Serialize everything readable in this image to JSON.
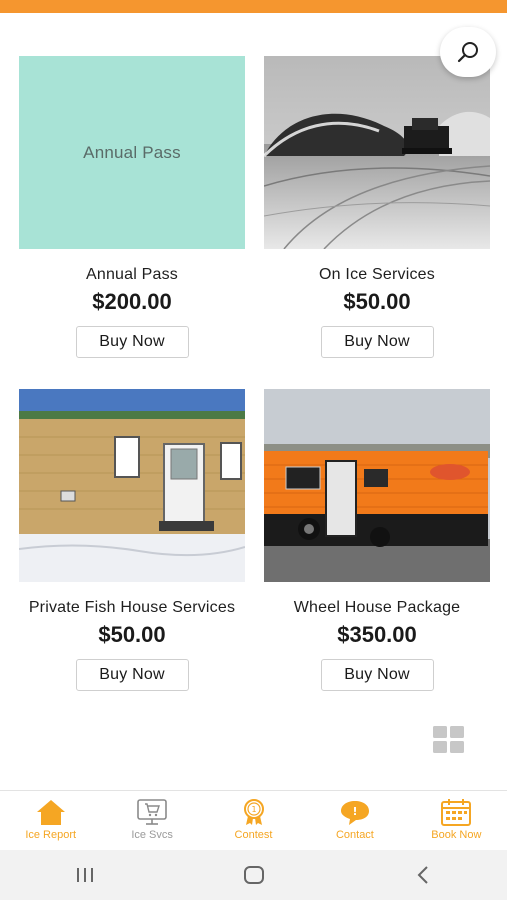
{
  "colors": {
    "accent": "#F5962F",
    "nav_active": "#F5A623",
    "placeholder_bg": "#A8E3D6"
  },
  "products": [
    {
      "name": "Annual Pass",
      "price": "$200.00",
      "button": "Buy Now",
      "image_text": "Annual Pass"
    },
    {
      "name": "On Ice Services",
      "price": "$50.00",
      "button": "Buy Now"
    },
    {
      "name": "Private Fish House Services",
      "price": "$50.00",
      "button": "Buy Now"
    },
    {
      "name": "Wheel House Package",
      "price": "$350.00",
      "button": "Buy Now"
    }
  ],
  "nav": {
    "items": [
      {
        "label": "Ice Report",
        "icon": "home-icon"
      },
      {
        "label": "Ice Svcs",
        "icon": "cart-monitor-icon"
      },
      {
        "label": "Contest",
        "icon": "award-icon"
      },
      {
        "label": "Contact",
        "icon": "chat-icon"
      },
      {
        "label": "Book Now",
        "icon": "calendar-icon"
      }
    ]
  }
}
